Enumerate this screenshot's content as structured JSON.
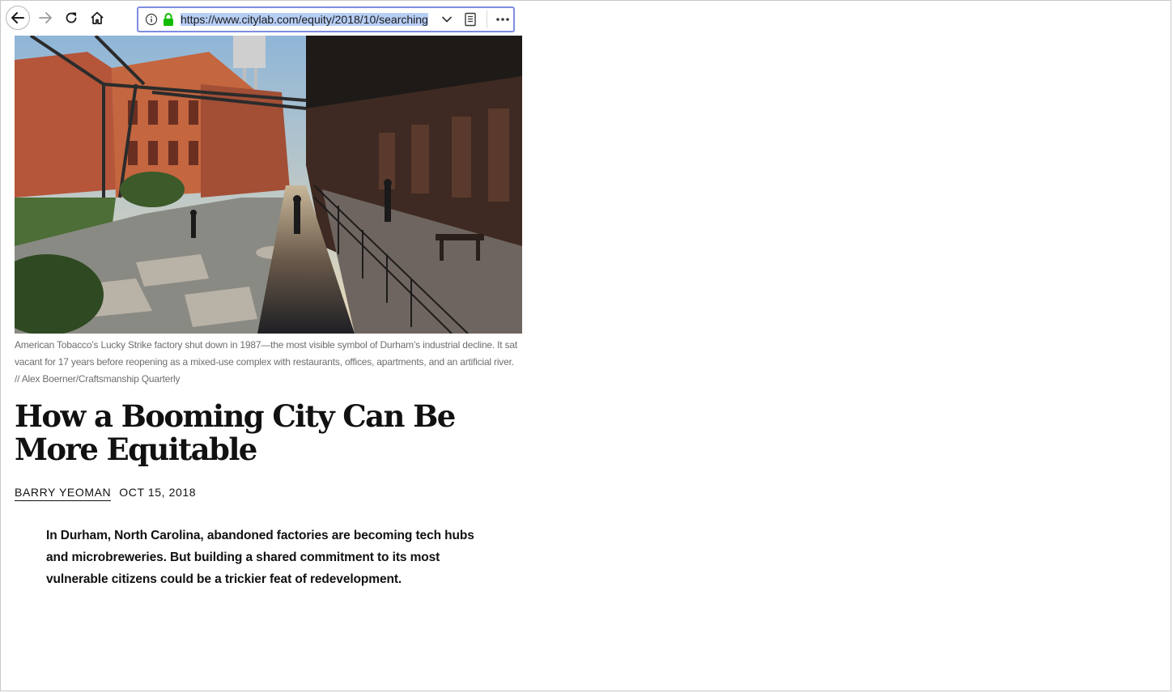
{
  "browser": {
    "url": "https://www.citylab.com/equity/2018/10/searching",
    "back_icon": "arrow-left-icon",
    "forward_icon": "arrow-right-icon",
    "reload_icon": "reload-icon",
    "home_icon": "home-icon",
    "info_icon": "info-icon",
    "lock_icon": "lock-icon",
    "dropdown_icon": "chevron-down-icon",
    "reader_icon": "reader-view-icon",
    "more_icon": "more-options-icon",
    "url_highlight_color": "#b7cef5",
    "urlbar_border_color": "#7e8ce0",
    "lock_color": "#12bc00"
  },
  "article": {
    "image_alt": "American Tobacco campus with stepping stones across an artificial river",
    "caption": "American Tobacco’s Lucky Strike factory shut down in 1987—the most visible symbol of Durham’s industrial decline. It sat vacant for 17 years before reopening as a mixed-use complex with restaurants, offices, apartments, and an artificial river. // Alex Boerner/Craftsmanship Quarterly",
    "headline": "How a Booming City Can Be More Equitable",
    "author": "BARRY YEOMAN",
    "date": "OCT 15, 2018",
    "dek": "In Durham, North Carolina, abandoned factories are becoming tech hubs and microbreweries. But building a shared commitment to its most vulnerable citizens could be a trickier feat of redevelopment."
  }
}
